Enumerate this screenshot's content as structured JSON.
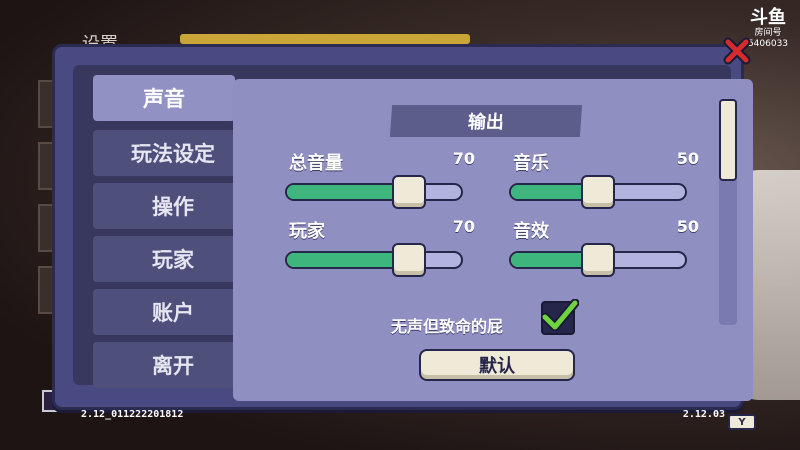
{
  "watermark": {
    "logo": "斗鱼",
    "label": "房间号",
    "number": "5406033"
  },
  "background": {
    "title": "设置"
  },
  "tabs": [
    {
      "label": "声音",
      "active": true
    },
    {
      "label": "玩法设定",
      "active": false
    },
    {
      "label": "操作",
      "active": false
    },
    {
      "label": "玩家",
      "active": false
    },
    {
      "label": "账户",
      "active": false
    },
    {
      "label": "离开",
      "active": false
    }
  ],
  "section": {
    "header": "输出"
  },
  "sliders": [
    {
      "label": "总音量",
      "value": "70",
      "level": 0.7
    },
    {
      "label": "音乐",
      "value": "50",
      "level": 0.5
    },
    {
      "label": "玩家",
      "value": "70",
      "level": 0.7
    },
    {
      "label": "音效",
      "value": "50",
      "level": 0.5
    }
  ],
  "checkbox": {
    "label": "无声但致命的屁",
    "checked": true
  },
  "default_button": {
    "label": "默认"
  },
  "versions": {
    "left": "2.12_011222201812",
    "right": "2.12.03"
  },
  "keys": {
    "y": "Y"
  },
  "colors": {
    "panel": "#4a4a82",
    "content": "#8f8fc2",
    "slider_fill": "#3fb57e",
    "slider_track": "#b3b3e0",
    "handle": "#efe9d8",
    "close_red": "#d62b2b",
    "check_green": "#6ed43f"
  }
}
